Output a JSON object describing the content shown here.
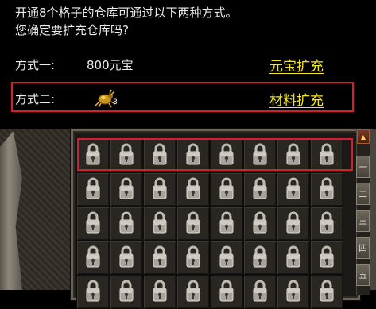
{
  "dialog": {
    "line1": "开通8个格子的仓库可通过以下两种方式。",
    "line2": "您确定要扩充仓库吗?"
  },
  "method1": {
    "label": "方式一:",
    "cost": "800元宝",
    "action": "元宝扩充"
  },
  "method2": {
    "label": "方式二:",
    "item_icon": "gold-beetle-icon",
    "item_count": "8",
    "action": "材料扩充"
  },
  "warehouse": {
    "cell_icon": "padlock-icon",
    "rows": 5,
    "cols": 8
  },
  "colors": {
    "link": "#f4e81a",
    "highlight_border": "#d4202e"
  },
  "scrollbar": {
    "up_icon": "▲"
  },
  "side_tabs": [
    "一",
    "二",
    "三",
    "四",
    "五"
  ]
}
